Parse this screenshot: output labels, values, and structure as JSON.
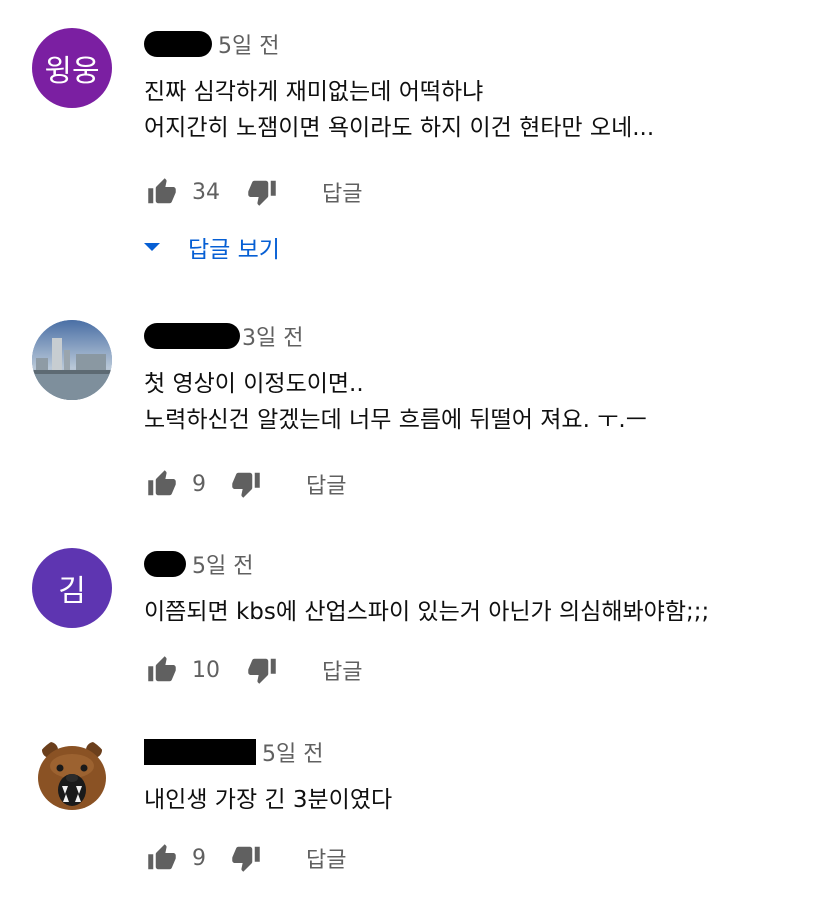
{
  "comments": [
    {
      "avatar_text": "윙웅",
      "avatar_color": "#7b1fa2",
      "time": "5일 전",
      "lines": [
        "진짜 심각하게 재미없는데 어떡하냐",
        "어지간히 노잼이면 욕이라도 하지 이건 현타만 오네..."
      ],
      "likes": "34",
      "reply_label": "답글",
      "replies_toggle": "답글 보기"
    },
    {
      "avatar_text": "",
      "time": "3일 전",
      "lines": [
        "첫 영상이 이정도이면..",
        "노력하신건 알겠는데 너무 흐름에 뒤떨어 져요. ㅜ.ㅡ"
      ],
      "likes": "9",
      "reply_label": "답글"
    },
    {
      "avatar_text": "김",
      "avatar_color": "#5e35b1",
      "time": "5일 전",
      "lines": [
        "이쯤되면 kbs에 산업스파이 있는거 아닌가 의심해봐야함;;;"
      ],
      "likes": "10",
      "reply_label": "답글"
    },
    {
      "avatar_text": "",
      "time": "5일 전",
      "lines": [
        "내인생 가장 긴 3분이였다"
      ],
      "likes": "9",
      "reply_label": "답글"
    }
  ],
  "colors": {
    "text": "#0f0f0f",
    "secondary": "#606060",
    "link": "#065fd4"
  },
  "icons": [
    "thumb-up-icon",
    "thumb-down-icon",
    "caret-down-icon"
  ]
}
